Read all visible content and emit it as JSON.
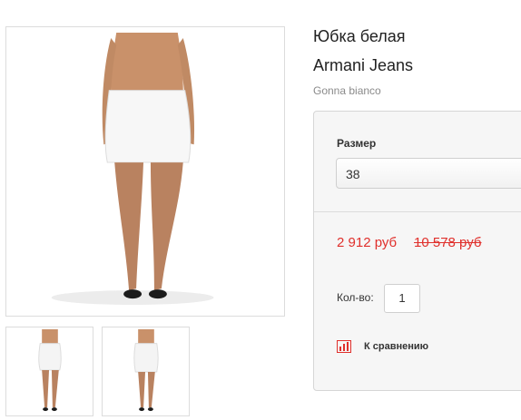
{
  "product": {
    "title": "Юбка белая",
    "brand": "Armani Jeans",
    "subtitle": "Gonna bianco"
  },
  "purchase_panel": {
    "size_label": "Размер",
    "size_selected": "38",
    "price_current": "2 912 руб",
    "price_old": "10 578 руб",
    "quantity_label": "Кол-во:",
    "quantity_value": "1",
    "compare_label": "К сравнению",
    "compare_icon": "bar-chart-icon"
  },
  "colors": {
    "price": "#e0302c",
    "panel_background": "#f6f6f6",
    "border": "#d6d6d6"
  }
}
